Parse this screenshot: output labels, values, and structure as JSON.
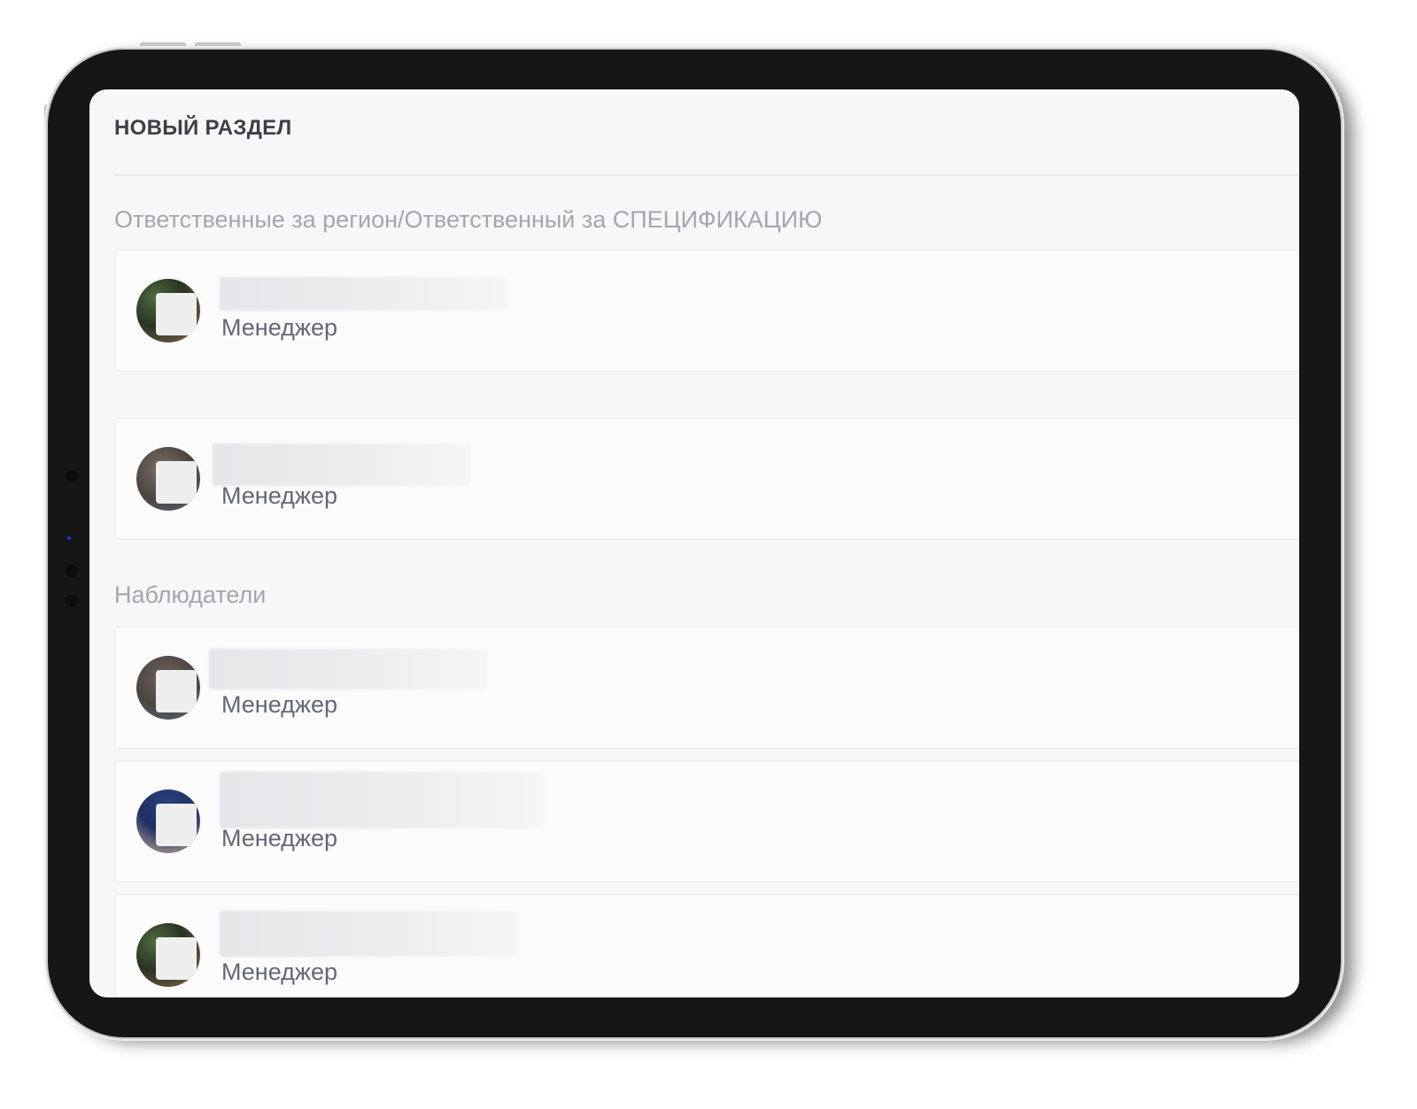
{
  "page": {
    "section_title": "НОВЫЙ РАЗДЕЛ"
  },
  "groups": [
    {
      "label": "Ответственные за регион/Ответственный за СПЕЦИФИКАЦИЮ",
      "people": [
        {
          "role": "Менеджер",
          "avatar": "user-avatar"
        },
        {
          "role": "Менеджер",
          "avatar": "user-avatar"
        }
      ]
    },
    {
      "label": "Наблюдатели",
      "people": [
        {
          "role": "Менеджер",
          "avatar": "user-avatar"
        },
        {
          "role": "Менеджер",
          "avatar": "user-avatar"
        },
        {
          "role": "Менеджер",
          "avatar": "user-avatar"
        }
      ]
    }
  ],
  "colors": {
    "device_frame": "#161616",
    "screen_background": "#f6f7f9",
    "card_background": "#fbfbfc",
    "label_text": "#a2a7af",
    "role_text": "#636873"
  }
}
